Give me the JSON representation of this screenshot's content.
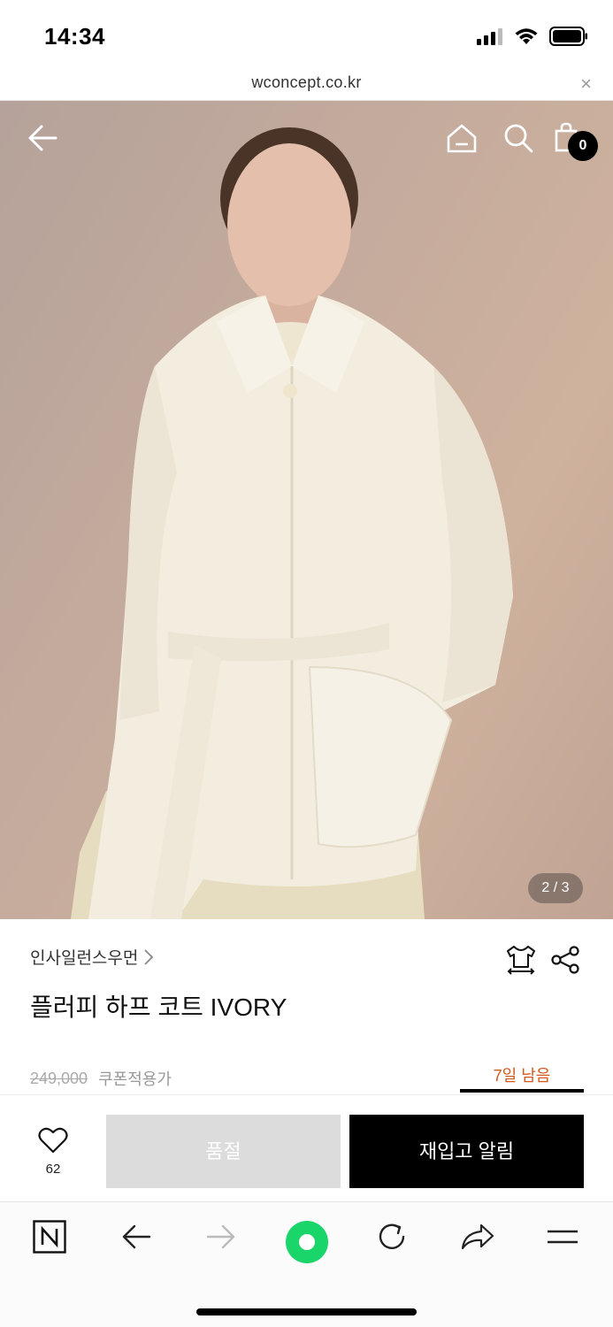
{
  "status_bar": {
    "time": "14:34"
  },
  "url_bar": {
    "url": "wconcept.co.kr",
    "close": "×"
  },
  "hero": {
    "cart_count": "0",
    "page_indicator": "2 / 3"
  },
  "product": {
    "brand": "인사일런스우먼",
    "brand_chevron": "›",
    "title": "플러피 하프 코트 IVORY",
    "original_price": "249,000",
    "price_label": "쿠폰적용가",
    "days_left": "7일 남음"
  },
  "actions": {
    "wish_count": "62",
    "soldout_label": "품절",
    "restock_label": "재입고 알림"
  },
  "browser_toolbar": {
    "items": [
      "naver-icon",
      "back-arrow-icon",
      "forward-arrow-icon",
      "green-dot-icon",
      "reload-icon",
      "share-arrow-icon",
      "menu-icon"
    ]
  },
  "colors": {
    "accent_orange": "#d25a1e",
    "green": "#19d56a",
    "soldout_gray": "#dcdcdc"
  }
}
